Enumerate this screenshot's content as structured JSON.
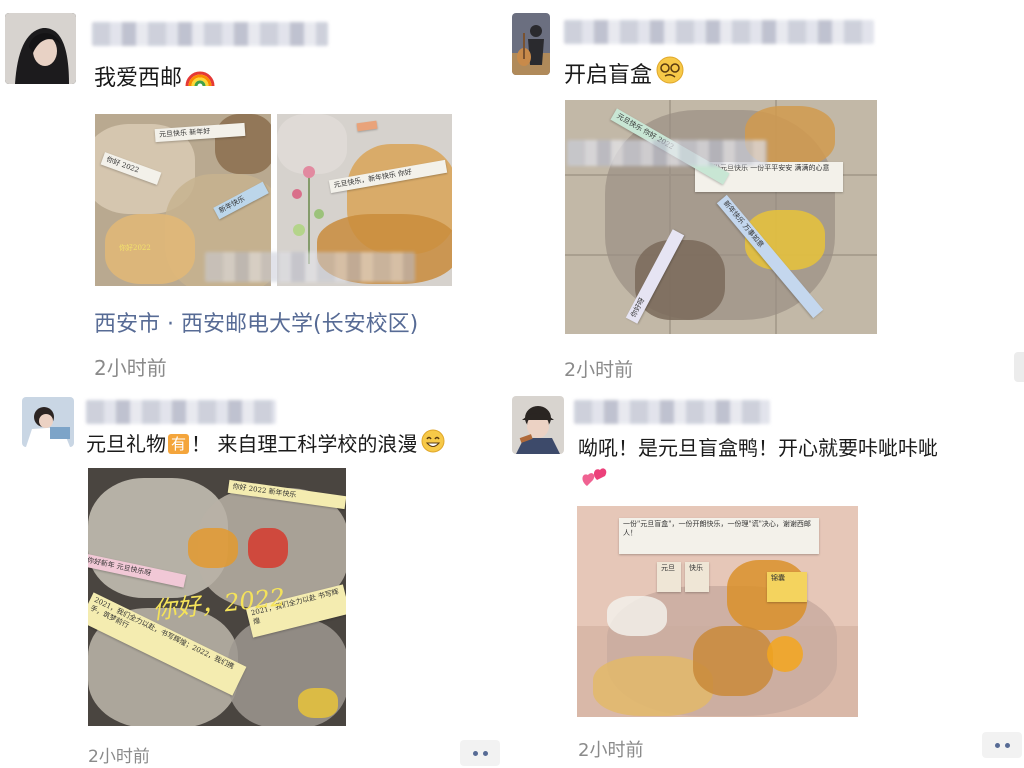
{
  "posts": [
    {
      "text": "我爱西邮",
      "emoji": "rainbow-emoji",
      "location": "西安市 · 西安邮电大学(长安校区)",
      "time": "2小时前"
    },
    {
      "text": "开启盲盒",
      "emoji": "nerd-face-emoji",
      "time": "2小时前"
    },
    {
      "text_before": "元旦礼物",
      "badge": "有",
      "text_after": "！ 来自理工科学校的浪漫",
      "emoji": "grin-emoji",
      "time": "2小时前",
      "photo_handwriting": "你好，2022"
    },
    {
      "text": "呦吼！是元旦盲盒鸭！开心就要咔呲咔呲",
      "emoji": "two-hearts-emoji",
      "time": "2小时前"
    }
  ],
  "colors": {
    "link": "#576b95",
    "time": "#8a8a8a",
    "badge": "#f4a53b"
  }
}
